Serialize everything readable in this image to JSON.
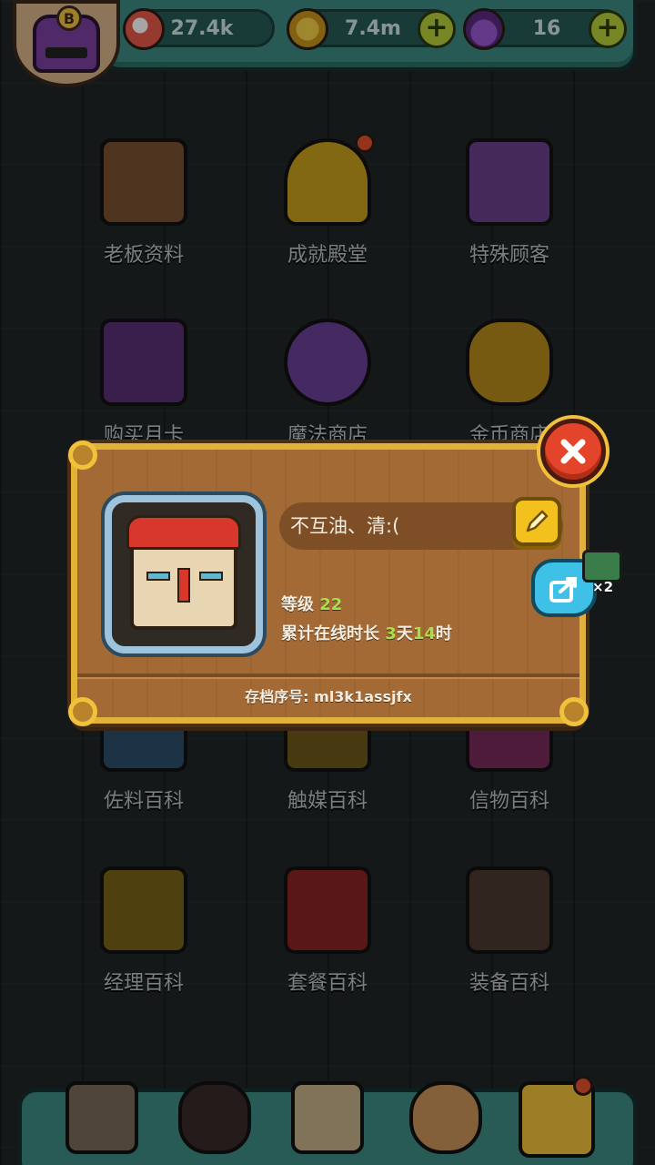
{
  "resources": {
    "eyes": {
      "value": "27.4k",
      "icon": "eyeball-icon"
    },
    "coins": {
      "value": "7.4m",
      "icon": "coin-icon"
    },
    "potions": {
      "value": "16",
      "icon": "potion-icon"
    }
  },
  "badge": {
    "letter": "B"
  },
  "menu": [
    {
      "label": "老板资料",
      "icon": "profile-card-icon",
      "notify": false
    },
    {
      "label": "成就殿堂",
      "icon": "trophy-icon",
      "notify": true
    },
    {
      "label": "特殊顾客",
      "icon": "customer-cards-icon",
      "notify": false
    },
    {
      "label": "购买月卡",
      "icon": "monthly-card-icon",
      "notify": false
    },
    {
      "label": "魔法商店",
      "icon": "potion-shop-icon",
      "notify": false
    },
    {
      "label": "金币商店",
      "icon": "coin-shop-icon",
      "notify": false
    },
    {
      "label": "佐料百科",
      "icon": "seasoning-book-icon",
      "notify": false
    },
    {
      "label": "触媒百科",
      "icon": "catalyst-book-icon",
      "notify": false
    },
    {
      "label": "信物百科",
      "icon": "token-book-icon",
      "notify": false
    },
    {
      "label": "经理百科",
      "icon": "manager-book-icon",
      "notify": false
    },
    {
      "label": "套餐百科",
      "icon": "meal-book-icon",
      "notify": false
    },
    {
      "label": "装备百科",
      "icon": "equipment-book-icon",
      "notify": false
    }
  ],
  "profile_dialog": {
    "player_name": "不互油、清:(",
    "level_label": "等级",
    "level_value": "22",
    "online_label": "累计在线时长",
    "online_days": "3",
    "online_days_unit": "天",
    "online_hours": "14",
    "online_hours_unit": "时",
    "save_id_text": "存档序号: ml3k1assjfx",
    "share_multiplier": "×2"
  },
  "bottom_nav": [
    {
      "icon": "shop-building-icon"
    },
    {
      "icon": "monster-icon"
    },
    {
      "icon": "book-icon"
    },
    {
      "icon": "money-bag-icon"
    },
    {
      "icon": "grid-menu-icon",
      "notify": true
    }
  ],
  "colors": {
    "accent_green": "#a7e04a",
    "dialog_wood": "#a36a35",
    "dialog_border": "#e2b238",
    "topbar_teal": "#3d8a83"
  }
}
